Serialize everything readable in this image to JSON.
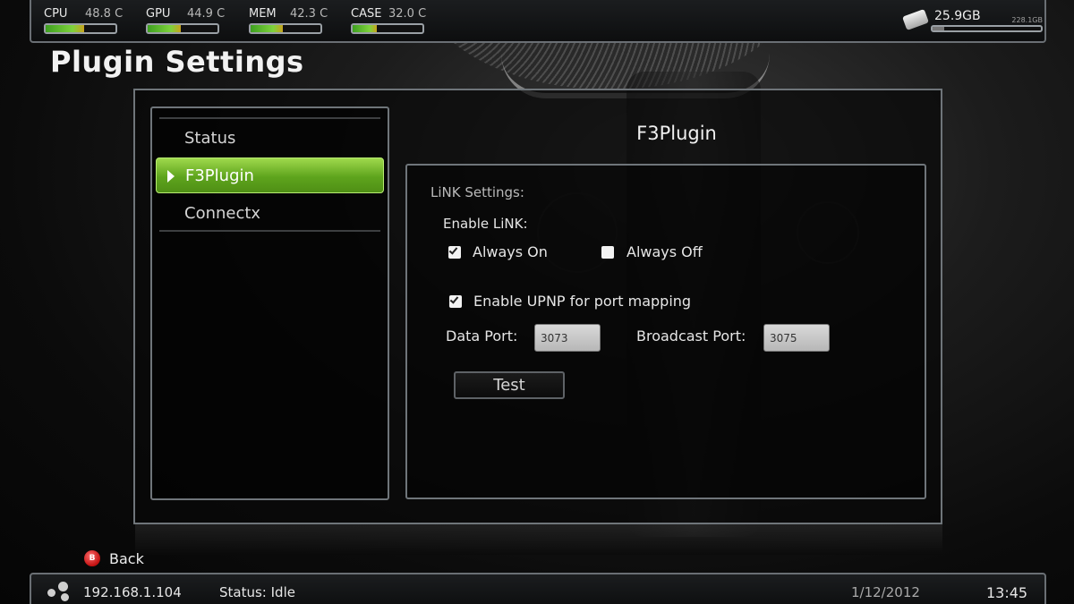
{
  "header": {
    "page_title": "Plugin Settings",
    "meters": [
      {
        "label": "CPU",
        "value": "48.8 C",
        "fill": 0.55
      },
      {
        "label": "GPU",
        "value": "44.9 C",
        "fill": 0.48
      },
      {
        "label": "MEM",
        "value": "42.3 C",
        "fill": 0.46
      },
      {
        "label": "CASE",
        "value": "32.0 C",
        "fill": 0.35
      }
    ],
    "disk": {
      "free": "25.9GB",
      "total": "228.1GB",
      "fill": 0.11,
      "icon": "usb-drive-icon"
    }
  },
  "sidebar": {
    "items": [
      {
        "label": "Status",
        "active": false
      },
      {
        "label": "F3Plugin",
        "active": true
      },
      {
        "label": "Connectx",
        "active": false
      }
    ]
  },
  "content": {
    "plugin_name": "F3Plugin",
    "link_settings_label": "LiNK Settings:",
    "enable_link_label": "Enable LiNK:",
    "always_on": {
      "label": "Always On",
      "checked": true
    },
    "always_off": {
      "label": "Always Off",
      "checked": false
    },
    "upnp": {
      "label": "Enable UPNP for port mapping",
      "checked": true
    },
    "data_port": {
      "label": "Data Port:",
      "value": "3073"
    },
    "broadcast_port": {
      "label": "Broadcast Port:",
      "value": "3075"
    },
    "test_button": "Test"
  },
  "footer": {
    "back_button_glyph": "B",
    "back_label": "Back",
    "ip": "192.168.1.104",
    "status": "Status: Idle",
    "date": "1/12/2012",
    "time": "13:45",
    "network_icon": "network-icon"
  },
  "colors": {
    "accent_green": "#5ea41d",
    "back_button_red": "#c11010"
  }
}
